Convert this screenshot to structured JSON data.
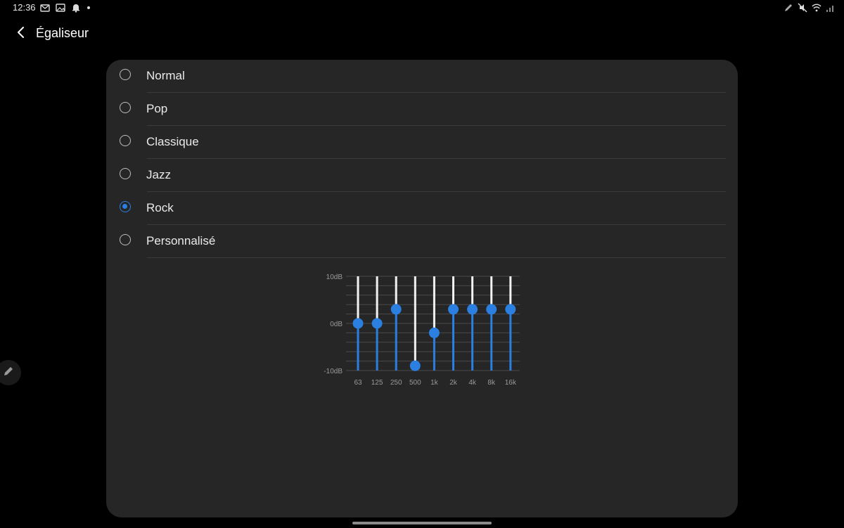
{
  "status_bar": {
    "time": "12:36",
    "left_icons": [
      "missed-call-icon",
      "gallery-icon",
      "notification-bell-icon",
      "dot-icon"
    ],
    "right_icons": [
      "pen-icon",
      "mute-icon",
      "wifi-icon",
      "signal-icon"
    ]
  },
  "app_bar": {
    "back_icon": "back-arrow-icon",
    "title": "Égaliseur"
  },
  "options": [
    {
      "label": "Normal",
      "selected": false
    },
    {
      "label": "Pop",
      "selected": false
    },
    {
      "label": "Classique",
      "selected": false
    },
    {
      "label": "Jazz",
      "selected": false
    },
    {
      "label": "Rock",
      "selected": true
    },
    {
      "label": "Personnalisé",
      "selected": false
    }
  ],
  "colors": {
    "accent": "#2a7fe0",
    "card": "#262626",
    "background": "#000000"
  },
  "chart_data": {
    "type": "bar",
    "title": "",
    "categories": [
      "63",
      "125",
      "250",
      "500",
      "1k",
      "2k",
      "4k",
      "8k",
      "16k"
    ],
    "values": [
      0,
      0,
      3,
      -9,
      -2,
      3,
      3,
      3,
      3
    ],
    "ylim": [
      -10,
      10
    ],
    "y_ticks": [
      "10dB",
      "0dB",
      "-10dB"
    ],
    "grid": true
  }
}
